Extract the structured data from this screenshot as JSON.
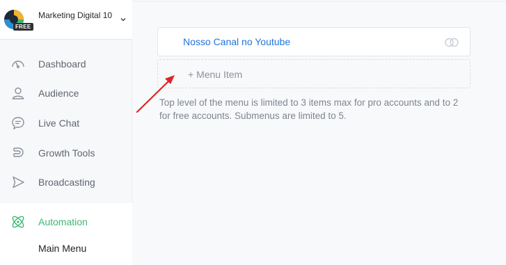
{
  "account": {
    "name": "Marketing Digital 10",
    "plan_badge": "FREE"
  },
  "sidebar": {
    "items": [
      {
        "label": "Dashboard",
        "icon": "dashboard-gauge-icon"
      },
      {
        "label": "Audience",
        "icon": "audience-person-icon"
      },
      {
        "label": "Live Chat",
        "icon": "live-chat-bubble-icon"
      },
      {
        "label": "Growth Tools",
        "icon": "growth-tools-magnet-icon"
      },
      {
        "label": "Broadcasting",
        "icon": "broadcasting-send-icon"
      }
    ],
    "active_item": {
      "label": "Automation",
      "icon": "automation-atom-icon"
    },
    "sub_item": {
      "label": "Main Menu"
    }
  },
  "main_menu": {
    "items": [
      {
        "label": "Nosso Canal no Youtube",
        "icon": "link-icon"
      }
    ],
    "add_item_label": "+ Menu Item",
    "hint": "Top level of the menu is limited to 3 items max for pro accounts and to 2 for free accounts. Submenus are limited to 5."
  },
  "colors": {
    "link": "#1f74d9",
    "active": "#3bb873",
    "annotation_arrow": "#e02424"
  }
}
